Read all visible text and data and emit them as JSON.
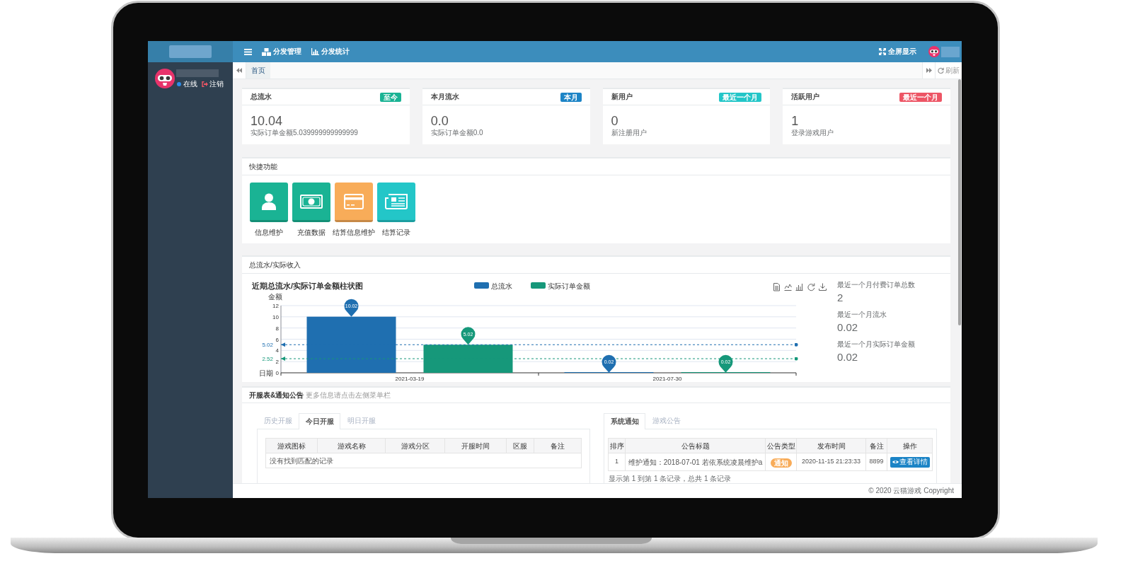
{
  "header": {
    "nav": [
      {
        "label": "分发管理"
      },
      {
        "label": "分发统计"
      }
    ],
    "fullscreen": "全屏显示"
  },
  "user_panel": {
    "status": "在线",
    "logout": "注销"
  },
  "page_tabs": [
    {
      "label": "首页",
      "selected": true
    }
  ],
  "tab_actions": {
    "refresh": "刷新"
  },
  "stat_cards": [
    {
      "title": "总流水",
      "badge": {
        "text": "至今",
        "color": "#1ab394"
      },
      "value": "10.04",
      "note": "实际订单金额5.039999999999999"
    },
    {
      "title": "本月流水",
      "badge": {
        "text": "本月",
        "color": "#1c84c6"
      },
      "value": "0.0",
      "note": "实际订单金额0.0"
    },
    {
      "title": "新用户",
      "badge": {
        "text": "最近一个月",
        "color": "#23c6c8"
      },
      "value": "0",
      "note": "新注册用户"
    },
    {
      "title": "活跃用户",
      "badge": {
        "text": "最近一个月",
        "color": "#ed5565"
      },
      "value": "1",
      "note": "登录游戏用户"
    }
  ],
  "quick_panel": {
    "title": "快捷功能",
    "items": [
      {
        "label": "信息维护",
        "color": "#1ab394"
      },
      {
        "label": "充值数据",
        "color": "#1ab394"
      },
      {
        "label": "结算信息维护",
        "color": "#f8ac59"
      },
      {
        "label": "结算记录",
        "color": "#23c6c8"
      }
    ]
  },
  "chart_panel": {
    "title": "总流水/实际收入",
    "chart_data": {
      "type": "bar",
      "title": "近期总流水/实际订单金额柱状图",
      "xlabel": "日期",
      "ylabel": "金额",
      "categories": [
        "2021-03-19",
        "2021-07-30"
      ],
      "series": [
        {
          "name": "总流水",
          "color": "#1f6fb0",
          "values": [
            10.02,
            0.02
          ]
        },
        {
          "name": "实际订单金额",
          "color": "#16987a",
          "values": [
            5.02,
            0.02
          ]
        }
      ],
      "ylim": [
        0,
        12
      ],
      "yticks": [
        {
          "value": 0,
          "label": "0"
        },
        {
          "value": 2,
          "label": "2"
        },
        {
          "value": 4,
          "label": "4"
        },
        {
          "value": 6,
          "label": "6"
        },
        {
          "value": 8,
          "label": "8"
        },
        {
          "value": 10,
          "label": "10"
        },
        {
          "value": 12,
          "label": "12"
        }
      ],
      "grid": true,
      "legend": "upper center",
      "data_labels": true,
      "ref_lines": [
        {
          "axis": "y",
          "value": 5.02,
          "label": "5.02",
          "color": "#1f6fb0"
        },
        {
          "axis": "y",
          "value": 2.52,
          "label": "2.52",
          "color": "#16987a"
        }
      ]
    },
    "stats": [
      {
        "label": "最近一个月付费订单总数",
        "value": "2"
      },
      {
        "label": "最近一个月流水",
        "value": "0.02"
      },
      {
        "label": "最近一个月实际订单金额",
        "value": "0.02"
      }
    ]
  },
  "server_panel": {
    "title": "开服表&通知公告",
    "hint": "更多信息请点击左侧菜单栏",
    "schedule": {
      "tabs": [
        {
          "label": "历史开服",
          "selected": false
        },
        {
          "label": "今日开服",
          "selected": true
        },
        {
          "label": "明日开服",
          "selected": false
        }
      ],
      "columns": [
        "游戏图标",
        "游戏名称",
        "游戏分区",
        "开服时间",
        "区服",
        "备注"
      ],
      "empty_text": "没有找到匹配的记录"
    },
    "notices": {
      "tabs": [
        {
          "label": "系统通知",
          "selected": true
        },
        {
          "label": "游戏公告",
          "selected": false
        }
      ],
      "columns": [
        "排序",
        "公告标题",
        "公告类型",
        "发布时间",
        "备注",
        "操作"
      ],
      "rows": [
        {
          "rank": "1",
          "title": "维护通知：2018-07-01 若依系统凌晨维护a",
          "type": "通知",
          "published": "2020-11-15 21:23:33",
          "remark": "8899",
          "action": "查看详情"
        }
      ],
      "pagination": "显示第 1 到第 1 条记录，总共 1 条记录"
    }
  },
  "footer": "© 2020 云猫游戏 Copyright"
}
